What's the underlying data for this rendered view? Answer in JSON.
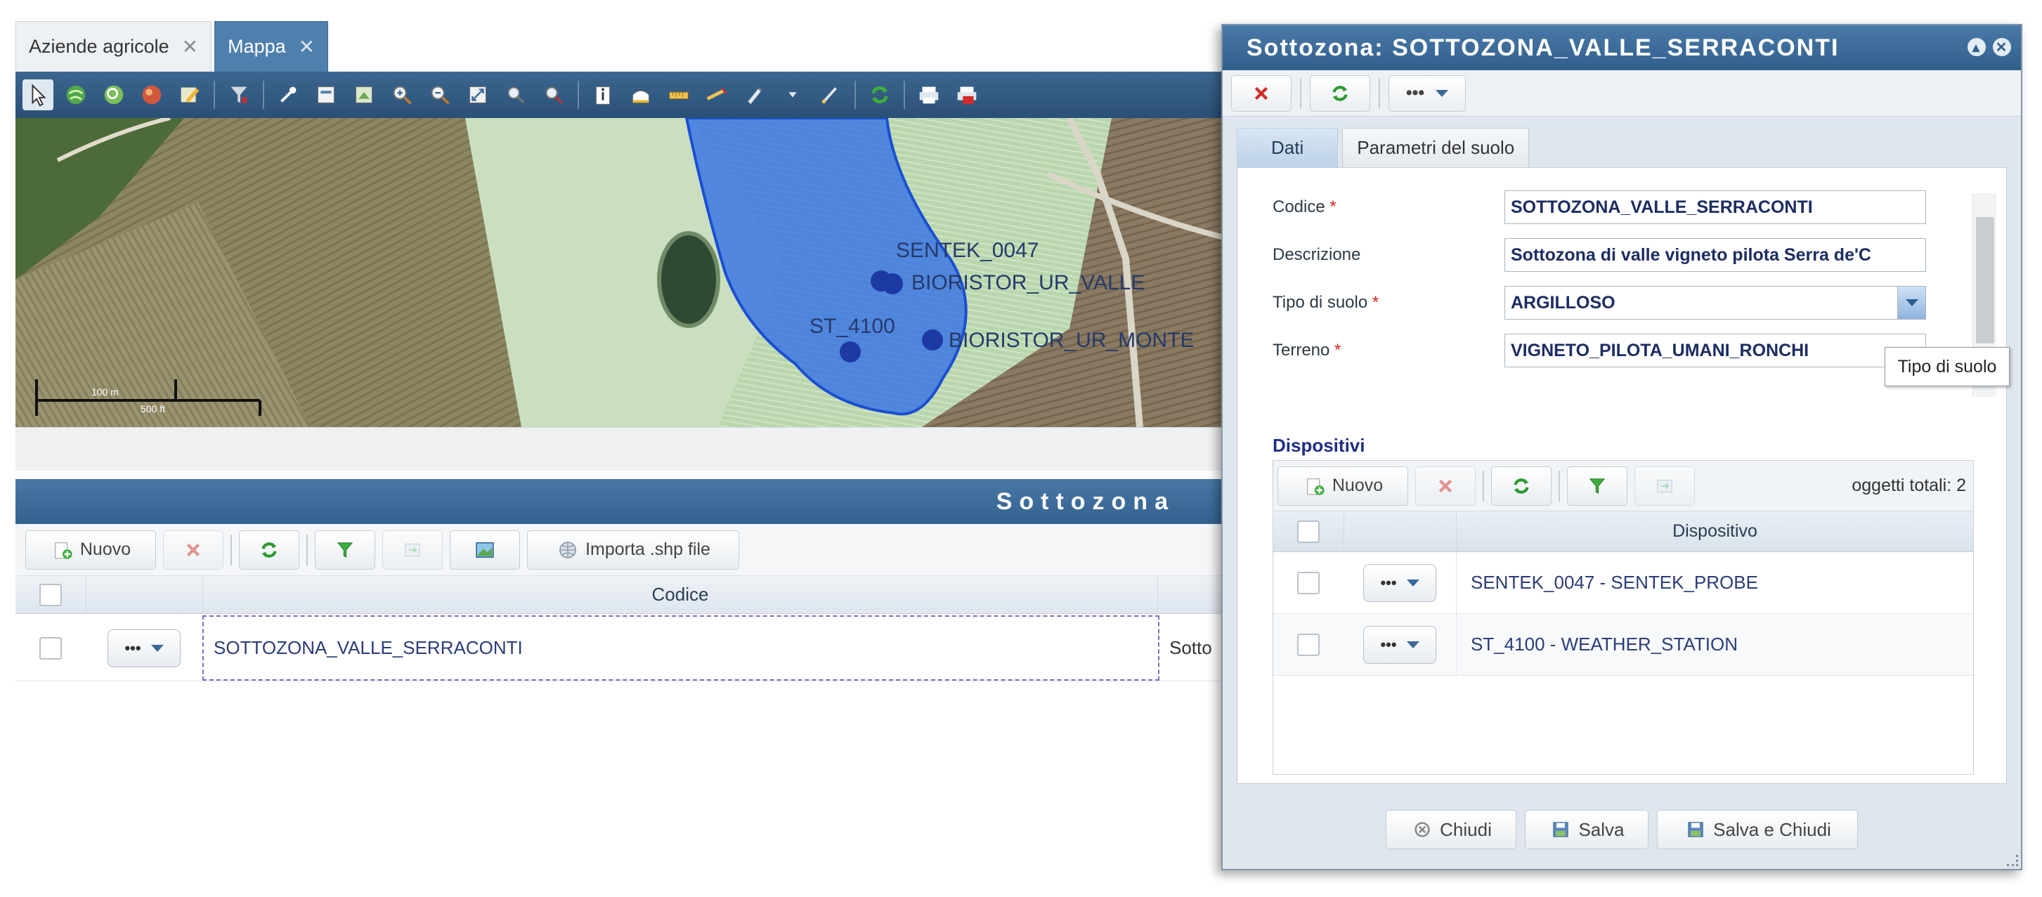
{
  "app_tabs": [
    {
      "label": "Aziende agricole"
    },
    {
      "label": "Mappa"
    }
  ],
  "map": {
    "labels": {
      "sensor1": "SENTEK_0047",
      "sensor2": "BIORISTOR_UR_VALLE",
      "sensor3": "ST_4100",
      "sensor4": "BIORISTOR_UR_MONTE"
    },
    "scale": {
      "metric": "100 m",
      "imperial": "500 ft"
    }
  },
  "list_panel": {
    "title": "Sottozona",
    "toolbar": {
      "new_label": "Nuovo",
      "import_label": "Importa .shp file"
    },
    "columns": {
      "codice": "Codice"
    },
    "rows": [
      {
        "more": "•••",
        "codice": "SOTTOZONA_VALLE_SERRACONTI",
        "descr_truncated": "Sotto"
      }
    ]
  },
  "dialog": {
    "title": "Sottozona: SOTTOZONA_VALLE_SERRACONTI",
    "more_label": "•••",
    "tabs": [
      {
        "label": "Dati"
      },
      {
        "label": "Parametri del suolo"
      }
    ],
    "form": {
      "codice": {
        "label": "Codice",
        "required": "*",
        "value": "SOTTOZONA_VALLE_SERRACONTI"
      },
      "descrizione": {
        "label": "Descrizione",
        "value": "Sottozona di valle vigneto pilota Serra de'C"
      },
      "tipo_suolo": {
        "label": "Tipo di suolo",
        "required": "*",
        "value": "ARGILLOSO"
      },
      "terreno": {
        "label": "Terreno",
        "required": "*",
        "value": "VIGNETO_PILOTA_UMANI_RONCHI"
      }
    },
    "tooltip": "Tipo di suolo",
    "dispositivi": {
      "title": "Dispositivi",
      "new_label": "Nuovo",
      "count_label": "oggetti totali: 2",
      "column": "Dispositivo",
      "rows": [
        {
          "more": "•••",
          "label": "SENTEK_0047 - SENTEK_PROBE"
        },
        {
          "more": "•••",
          "label": "ST_4100 - WEATHER_STATION"
        }
      ]
    },
    "footer": {
      "close": "Chiudi",
      "save": "Salva",
      "save_close": "Salva e Chiudi"
    }
  },
  "colors": {
    "accent": "#3b6a98",
    "polygon": "#2f6ee8",
    "required": "#d3261f"
  }
}
